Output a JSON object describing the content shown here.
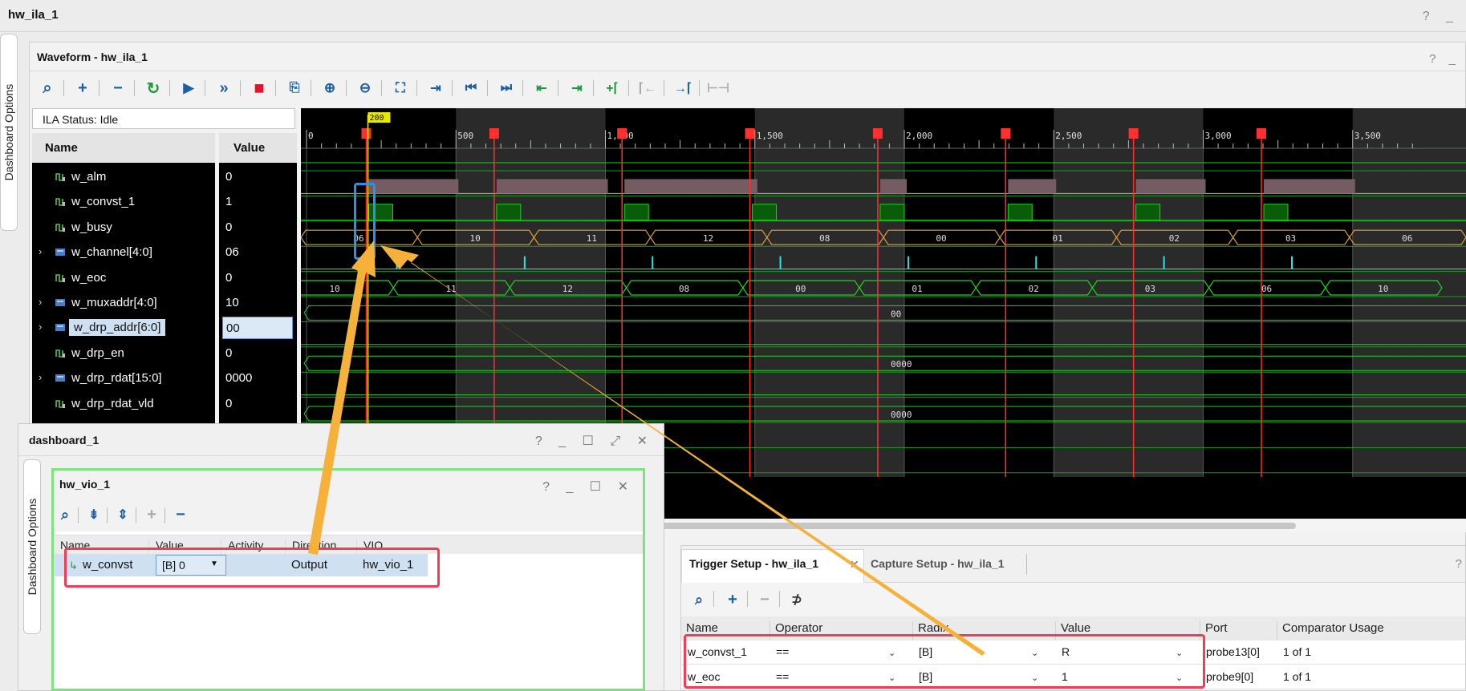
{
  "window": {
    "title": "hw_ila_1",
    "controls": "? _"
  },
  "side_tab_top": "Dashboard Options",
  "waveform": {
    "title": "Waveform - hw_ila_1",
    "controls": "? _",
    "ila_status": "ILA Status: Idle",
    "col_name": "Name",
    "col_value": "Value",
    "cursor_label": "200",
    "ruler": [
      "0",
      "500",
      "1,000",
      "1,500",
      "2,000",
      "2,500",
      "3,000",
      "3,500"
    ],
    "signals": [
      {
        "name": "w_alm",
        "value": "0",
        "bus": false
      },
      {
        "name": "w_convst_1",
        "value": "1",
        "bus": false
      },
      {
        "name": "w_busy",
        "value": "0",
        "bus": false
      },
      {
        "name": "w_channel[4:0]",
        "value": "06",
        "bus": true
      },
      {
        "name": "w_eoc",
        "value": "0",
        "bus": false
      },
      {
        "name": "w_muxaddr[4:0]",
        "value": "10",
        "bus": true
      },
      {
        "name": "w_drp_addr[6:0]",
        "value": "00",
        "bus": true
      },
      {
        "name": "w_drp_en",
        "value": "0",
        "bus": false
      },
      {
        "name": "w_drp_rdat[15:0]",
        "value": "0000",
        "bus": true
      },
      {
        "name": "w_drp_rdat_vld",
        "value": "0",
        "bus": false
      }
    ],
    "channel_values": [
      "06",
      "10",
      "11",
      "12",
      "08",
      "00",
      "01",
      "02",
      "03",
      "06"
    ],
    "muxaddr_values": [
      "10",
      "11",
      "12",
      "08",
      "00",
      "01",
      "02",
      "03",
      "06",
      "10"
    ],
    "drp_addr_value": "00",
    "drp_rdat_value": "0000",
    "extra_value": "0000"
  },
  "dashboard": {
    "title": "dashboard_1",
    "controls": "? _ ☐ ⤢ ✕",
    "side_tab": "Dashboard Options",
    "vio": {
      "title": "hw_vio_1",
      "controls": "? _ ☐ ✕",
      "headers": [
        "Name",
        "Value",
        "Activity",
        "Direction",
        "VIO"
      ],
      "row": {
        "name": "w_convst",
        "value": "[B] 0",
        "activity": "",
        "direction": "Output",
        "vio": "hw_vio_1"
      }
    }
  },
  "trigger": {
    "tab1": "Trigger Setup - hw_ila_1",
    "tab2": "Capture Setup - hw_ila_1",
    "help": "?",
    "headers": [
      "Name",
      "Operator",
      "Radix",
      "Value",
      "Port",
      "Comparator Usage"
    ],
    "rows": [
      {
        "name": "w_convst_1",
        "operator": "==",
        "radix": "[B]",
        "value": "R",
        "port": "probe13[0]",
        "usage": "1 of 1"
      },
      {
        "name": "w_eoc",
        "operator": "==",
        "radix": "[B]",
        "value": "1",
        "port": "probe9[0]",
        "usage": "1 of 1"
      }
    ]
  },
  "colors": {
    "waveform_bg": "#000000",
    "signal_green": "#1fd21f",
    "bus_orange": "#e3a23a",
    "eoc_cyan": "#31e3e3",
    "trigger_red": "#ff3030",
    "cursor_yellow": "#e8e800",
    "highlight_red": "#ef3e57",
    "highlight_blue": "#2a93e8",
    "arrow_orange": "#f5b13a"
  }
}
